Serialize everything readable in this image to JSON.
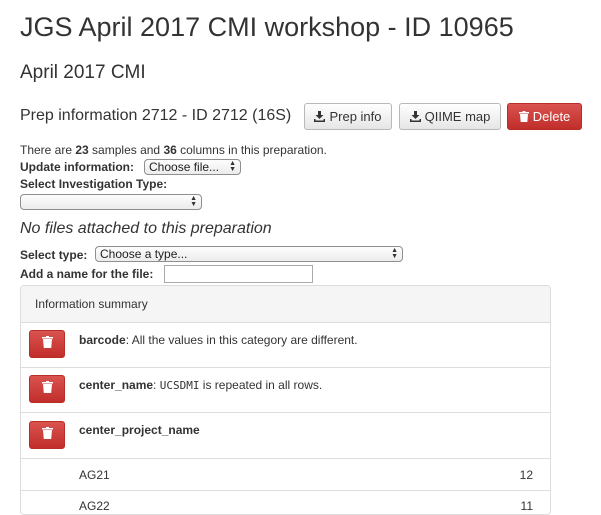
{
  "page": {
    "title": "JGS April 2017 CMI workshop - ID 10965",
    "subtitle": "April 2017 CMI"
  },
  "prep": {
    "title": "Prep information 2712 - ID 2712 (16S)",
    "buttons": {
      "prep_info": "Prep info",
      "qiime_map": "QIIME map",
      "delete": "Delete"
    },
    "summary": {
      "prefix": "There are ",
      "samples": "23",
      "middle": " samples and ",
      "columns": "36",
      "suffix": " columns in this preparation."
    },
    "update_label": "Update information:",
    "file_button": "Choose file...",
    "investigation_label": "Select Investigation Type:",
    "investigation_value": "",
    "no_files": "No files attached to this preparation",
    "select_type_label": "Select type:",
    "select_type_value": "Choose a type...",
    "add_name_label": "Add a name for the file:",
    "add_name_value": ""
  },
  "info_summary": {
    "heading": "Information summary",
    "rows": [
      {
        "name": "barcode",
        "text": ": All the values in this category are different.",
        "code": "",
        "rest": ""
      },
      {
        "name": "center_name",
        "text": ": ",
        "code": "UCSDMI",
        "rest": " is repeated in all rows."
      },
      {
        "name": "center_project_name",
        "text": "",
        "code": "",
        "rest": ""
      }
    ],
    "values": [
      {
        "label": "AG21",
        "count": "12"
      },
      {
        "label": "AG22",
        "count": "11"
      }
    ]
  },
  "icons": {
    "download": "download-icon",
    "trash": "trash-icon",
    "select_arrows": "updown-arrows-icon"
  },
  "colors": {
    "danger": "#d9534f",
    "panel_head": "#f5f5f5",
    "border": "#dddddd"
  }
}
